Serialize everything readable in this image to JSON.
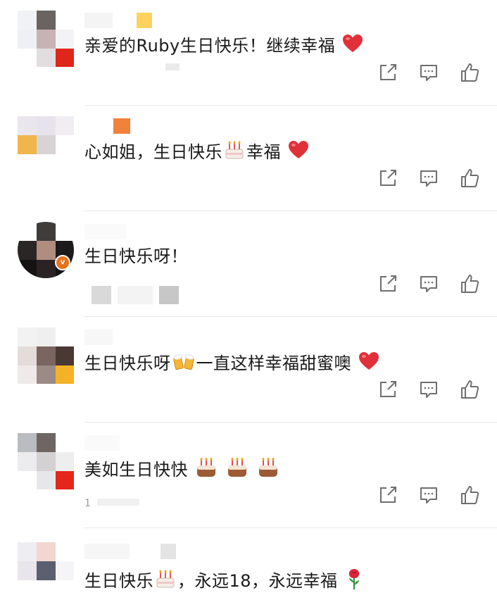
{
  "comments": [
    {
      "text": "亲爱的Ruby生日快乐！继续幸福",
      "emoji": "heart-icon"
    },
    {
      "text_before": "心如姐，生日快乐",
      "text_after": "幸福",
      "emoji": "cake-icon"
    },
    {
      "text": "生日快乐呀！",
      "badge": "v"
    },
    {
      "text_before": "生日快乐呀",
      "text_after": "一直这样幸福甜蜜噢",
      "emoji": "beers-icon"
    },
    {
      "text": "美如生日快快",
      "emoji": "cake-icon",
      "meta_text": "1"
    },
    {
      "text_before": "生日快乐",
      "text_after": "，永远18，永远幸福",
      "emoji": "rose-icon"
    }
  ],
  "colors": {
    "icon_stroke": "#6f6f6f",
    "divider": "#e8e8e8",
    "heart": "#e0303a",
    "text": "#1a1a1a"
  }
}
